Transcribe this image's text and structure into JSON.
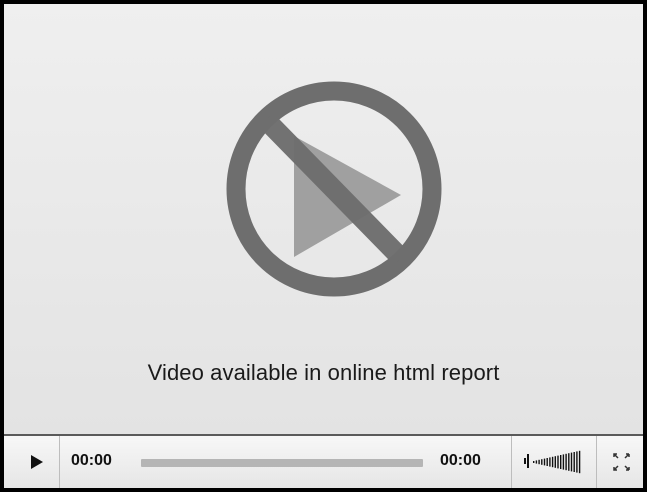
{
  "player": {
    "message": "Video available in online html report",
    "current_time": "00:00",
    "total_time": "00:00",
    "progress": 0
  },
  "icons": {
    "play": "play-icon",
    "volume": "volume-icon",
    "fullscreen": "fullscreen-icon",
    "unavailable": "no-video-icon"
  }
}
